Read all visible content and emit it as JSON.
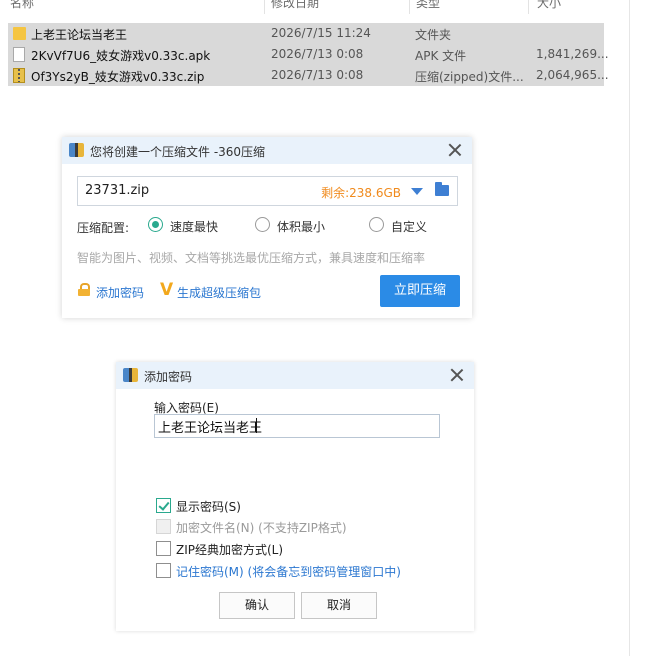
{
  "explorer": {
    "columns": {
      "name": "名称",
      "date": "修改日期",
      "type": "类型",
      "size": "大小"
    },
    "files": [
      {
        "icon": "folder-icon",
        "name": "上老王论坛当老王",
        "date": "2026/7/15 11:24",
        "type": "文件夹",
        "size": ""
      },
      {
        "icon": "apk-file-icon",
        "name": "2KvVf7U6_妓女游戏v0.33c.apk",
        "date": "2026/7/13 0:08",
        "type": "APK 文件",
        "size": "1,841,269..."
      },
      {
        "icon": "zip-file-icon",
        "name": "Of3Ys2yB_妓女游戏v0.33c.zip",
        "date": "2026/7/13 0:08",
        "type": "压缩(zipped)文件...",
        "size": "2,064,965..."
      }
    ]
  },
  "compress_dialog": {
    "title": "您将创建一个压缩文件 -360压缩",
    "filename": "23731.zip",
    "remaining": "剩余:238.6GB",
    "config_label": "压缩配置:",
    "options": [
      {
        "label": "速度最快",
        "checked": true
      },
      {
        "label": "体积最小",
        "checked": false
      },
      {
        "label": "自定义",
        "checked": false
      }
    ],
    "hint": "智能为图片、视频、文档等挑选最优压缩方式，兼具速度和压缩率",
    "add_password_link": "添加密码",
    "super_link": "生成超级压缩包",
    "compress_button": "立即压缩"
  },
  "password_dialog": {
    "title": "添加密码",
    "input_label": "输入密码(E)",
    "input_value": "上老王论坛当老王",
    "checkboxes": {
      "show_password": {
        "label": "显示密码(S)",
        "checked": true
      },
      "encrypt_filenames": {
        "label": "加密文件名(N)  (不支持ZIP格式)",
        "checked": false,
        "disabled": true
      },
      "zip_classic": {
        "label": "ZIP经典加密方式(L)",
        "checked": false
      },
      "remember": {
        "label": "记住密码(M)  (将会备忘到密码管理窗口中)",
        "checked": false
      }
    },
    "ok_button": "确认",
    "cancel_button": "取消"
  },
  "colors": {
    "accent_blue": "#2b8be6",
    "check_green": "#2aa98e",
    "remaining_orange": "#f08a1c",
    "selection_gray": "#d9d9d9"
  }
}
